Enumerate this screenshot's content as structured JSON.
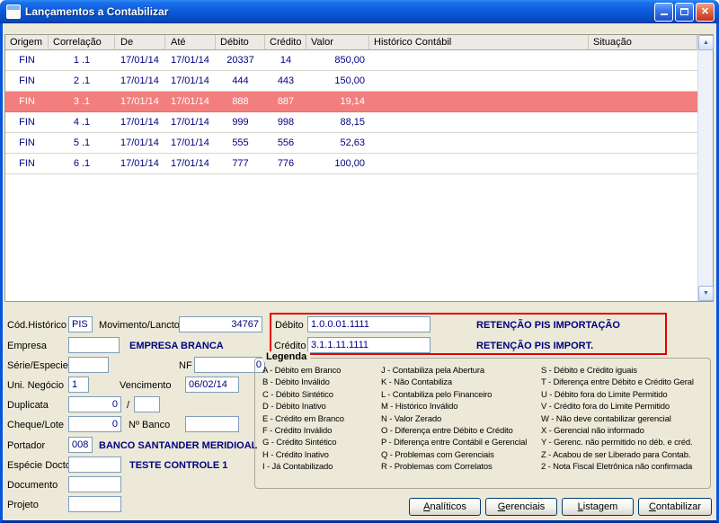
{
  "window": {
    "title": "Lançamentos a Contabilizar"
  },
  "grid": {
    "columns": [
      "Origem",
      "Correlação",
      "De",
      "Até",
      "Débito",
      "Crédito",
      "Valor",
      "Histórico Contábil",
      "Situação"
    ],
    "rows": [
      [
        "FIN",
        "1 .1",
        "17/01/14",
        "17/01/14",
        "20337",
        "14",
        "850,00",
        "",
        ""
      ],
      [
        "FIN",
        "2 .1",
        "17/01/14",
        "17/01/14",
        "444",
        "443",
        "150,00",
        "",
        ""
      ],
      [
        "FIN",
        "3 .1",
        "17/01/14",
        "17/01/14",
        "888",
        "887",
        "19,14",
        "",
        ""
      ],
      [
        "FIN",
        "4 .1",
        "17/01/14",
        "17/01/14",
        "999",
        "998",
        "88,15",
        "",
        ""
      ],
      [
        "FIN",
        "5 .1",
        "17/01/14",
        "17/01/14",
        "555",
        "556",
        "52,63",
        "",
        ""
      ],
      [
        "FIN",
        "6 .1",
        "17/01/14",
        "17/01/14",
        "777",
        "776",
        "100,00",
        "",
        ""
      ]
    ],
    "selected_row_index": 2
  },
  "form": {
    "cod_historico": {
      "label": "Cód.Histórico",
      "value": "PIS"
    },
    "movimento": {
      "label": "Movimento/Lancto",
      "value": "34767"
    },
    "debito": {
      "label": "Débito",
      "value": "1.0.0.01.1111",
      "desc": "RETENÇÃO PIS IMPORTAÇÃO"
    },
    "empresa": {
      "label": "Empresa",
      "value": "",
      "desc": "EMPRESA BRANCA"
    },
    "credito": {
      "label": "Crédito",
      "value": "3.1.1.11.1111",
      "desc": "RETENÇÃO PIS IMPORT."
    },
    "serie_especie": {
      "label": "Série/Especie",
      "value": ""
    },
    "nf": {
      "label": "NF",
      "value": "0"
    },
    "uni_negocio": {
      "label": "Uni. Negócio",
      "value": "1"
    },
    "vencimento": {
      "label": "Vencimento",
      "value": "06/02/14"
    },
    "duplicata": {
      "label": "Duplicata",
      "value": "0",
      "separator": "/",
      "value2": ""
    },
    "cheque_lote": {
      "label": "Cheque/Lote",
      "value": "0"
    },
    "num_banco": {
      "label": "Nº Banco",
      "value": ""
    },
    "portador": {
      "label": "Portador",
      "value": "008",
      "desc": "BANCO SANTANDER MERIDIOAL"
    },
    "especie_docto": {
      "label": "Espécie Docto",
      "value": "",
      "desc": "TESTE CONTROLE 1"
    },
    "documento": {
      "label": "Documento",
      "value": ""
    },
    "projeto": {
      "label": "Projeto",
      "value": ""
    }
  },
  "legend": {
    "title": "Legenda",
    "col1": [
      "A - Débito em Branco",
      "B - Débito Inválido",
      "C - Débito Sintético",
      "D - Débito Inativo",
      "E - Crédito em Branco",
      "F - Crédito Inválido",
      "G - Crédito Sintético",
      "H - Crédito Inativo",
      "I - Já Contabilizado"
    ],
    "col2": [
      "J - Contabiliza pela Abertura",
      "K - Não Contabiliza",
      "L - Contabiliza pelo Financeiro",
      "M - Histórico Inválido",
      "N - Valor Zerado",
      "O - Diferença entre Débito e Crédito",
      "P - Diferença entre Contábil e Gerencial",
      "Q - Problemas com Gerenciais",
      "R - Problemas com Correlatos"
    ],
    "col3": [
      "S - Débito e Crédito iguais",
      "T - Diferença entre Débito e Crédito Geral",
      "U - Débito fora do Limite Permitido",
      "V - Crédito fora do Limite Permitido",
      "W - Não deve contabilizar gerencial",
      "X - Gerencial não informado",
      "Y - Gerenc. não permitido no déb. e créd.",
      "Z - Acabou de ser Liberado para Contab.",
      "2 - Nota Fiscal Eletrônica não confirmada"
    ]
  },
  "buttons": [
    {
      "accel": "A",
      "rest": "nalíticos"
    },
    {
      "accel": "G",
      "rest": "erenciais"
    },
    {
      "accel": "L",
      "rest": "istagem"
    },
    {
      "accel": "C",
      "rest": "ontabilizar"
    }
  ],
  "colors": {
    "selected_row": "#F27E7E",
    "highlight_box": "#E60000",
    "grid_text": "#000080",
    "titlebar_blue": "#0D5BDD"
  }
}
